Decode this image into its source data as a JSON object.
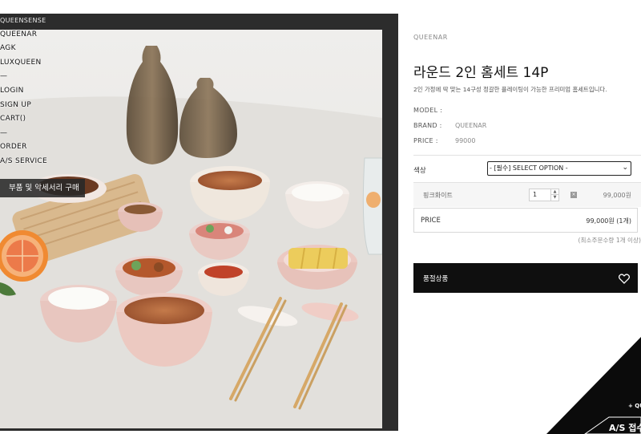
{
  "nav": {
    "items": [
      "QUEENSENSE",
      "QUEENAR",
      "AGK",
      "LUXQUEEN",
      "—",
      "LOGIN",
      "SIGN UP",
      "CART()",
      "—",
      "ORDER",
      "A/S SERVICE"
    ],
    "parts_banner": "부품 및 악세서리 구매"
  },
  "product": {
    "brand_top": "QUEENAR",
    "title": "라운드 2인 홈세트 14P",
    "description": "2인 가정에 딱 맞는 14구성 정갈한 플레이팅이 가능한 프리미엄 홈세트입니다.",
    "specs": {
      "model_label": "MODEL :",
      "model_value": "",
      "brand_label": "BRAND :",
      "brand_value": "QUEENAR",
      "price_label": "PRICE :",
      "price_value": "99000"
    }
  },
  "option": {
    "label": "색상",
    "select_value": "- [필수] SELECT OPTION -",
    "selected_name": "핑크화이트",
    "quantity": "1",
    "item_price": "99,000원",
    "delete_icon": "x-box-icon"
  },
  "total": {
    "label": "PRICE",
    "value": "99,000원 (1개)"
  },
  "min_order": "(최소주문수량 1개 이상)",
  "soldout_button": "품절상품",
  "wishlist_icon": "heart-icon",
  "corner_banner": {
    "plus": "+ QU",
    "as": "A/S 접수"
  }
}
